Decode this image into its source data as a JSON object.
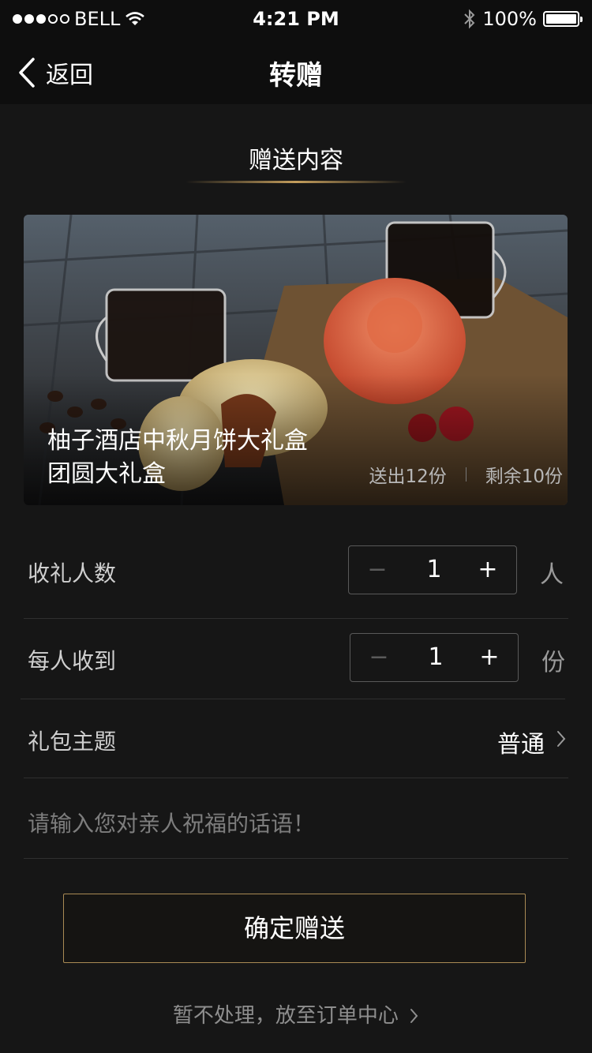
{
  "status": {
    "carrier": "BELL",
    "time": "4:21 PM",
    "battery": "100%",
    "signal_dots_filled": 3,
    "signal_dots_total": 5
  },
  "nav": {
    "back_label": "返回",
    "title": "转赠"
  },
  "section": {
    "title": "赠送内容"
  },
  "product": {
    "name_line1": "柚子酒店中秋月饼大礼盒",
    "name_line2": "团圆大礼盒",
    "sent": "送出12份",
    "remaining": "剩余10份"
  },
  "recipients": {
    "label": "收礼人数",
    "minus": "−",
    "value": "1",
    "plus": "+",
    "unit": "人"
  },
  "per_person": {
    "label": "每人收到",
    "minus": "−",
    "value": "1",
    "plus": "+",
    "unit": "份"
  },
  "theme": {
    "label": "礼包主题",
    "value": "普通"
  },
  "message": {
    "placeholder": "请输入您对亲人祝福的话语！"
  },
  "actions": {
    "confirm": "确定赠送",
    "later": "暂不处理，放至订单中心"
  },
  "icons": {
    "back": "chevron-left-icon",
    "wifi": "wifi-icon",
    "bluetooth": "bluetooth-icon",
    "battery": "battery-icon",
    "theme_chevron": "chevron-right-icon"
  },
  "colors": {
    "background": "#161616",
    "bar_background": "#0e0e0e",
    "gold_accent": "#c39d5c",
    "button_border": "#a98a54"
  }
}
